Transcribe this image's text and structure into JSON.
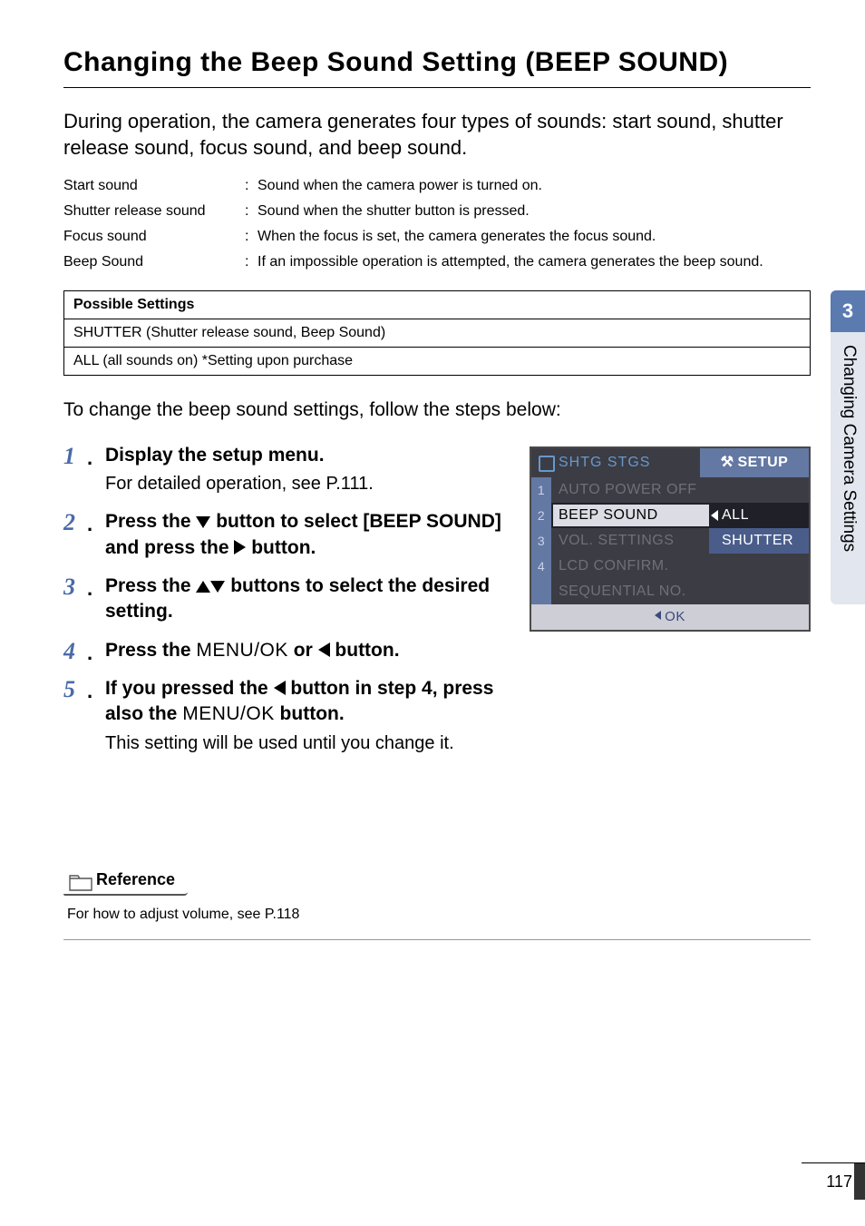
{
  "title": "Changing the Beep Sound Setting (BEEP SOUND)",
  "intro": "During operation, the camera generates four types of sounds: start sound, shutter release sound, focus sound, and beep sound.",
  "sounds": [
    {
      "name": "Start sound",
      "desc": "Sound when the camera power is turned on."
    },
    {
      "name": "Shutter release sound",
      "desc": "Sound when the shutter button is pressed."
    },
    {
      "name": "Focus sound",
      "desc": "When the focus is set, the camera generates the focus sound."
    },
    {
      "name": "Beep Sound",
      "desc": "If an impossible operation is attempted, the camera generates the beep sound."
    }
  ],
  "settings_table": {
    "header": "Possible Settings",
    "rows": [
      "SHUTTER (Shutter release sound, Beep Sound)",
      "ALL (all sounds on)  *Setting upon purchase"
    ]
  },
  "sub_intro": "To change the beep sound settings, follow the steps below:",
  "steps": {
    "s1": {
      "head": "Display the setup menu.",
      "sub": "For detailed operation, see P.111."
    },
    "s2": {
      "head_pre": "Press the ",
      "head_mid": " button to select [BEEP SOUND] and press the ",
      "head_post": " button."
    },
    "s3": {
      "head_pre": "Press the ",
      "head_post": " buttons to select the desired setting."
    },
    "s4": {
      "head_pre": "Press the ",
      "menu": "MENU/OK",
      "head_mid": " or ",
      "head_post": " button."
    },
    "s5": {
      "head_pre": "If you pressed the ",
      "head_mid": " button in step 4, press also the ",
      "menu": "MENU/OK",
      "head_post": " button.",
      "sub": "This setting will be used until you change it."
    }
  },
  "screenshot": {
    "header_left": "SHTG STGS",
    "header_right": "SETUP",
    "rows": [
      {
        "num": "1",
        "label": "AUTO POWER OFF",
        "val": ""
      },
      {
        "num": "2",
        "label": "BEEP SOUND",
        "val": "ALL",
        "selected": true,
        "arrow": true
      },
      {
        "num": "3",
        "label": "VOL. SETTINGS",
        "val": "SHUTTER",
        "valBlue": true
      },
      {
        "num": "4",
        "label": "LCD CONFIRM.",
        "val": ""
      },
      {
        "num": "",
        "label": "SEQUENTIAL NO.",
        "val": ""
      }
    ],
    "footer": "OK"
  },
  "reference": {
    "label": "Reference",
    "body": "For how to adjust volume, see P.118"
  },
  "side_tab": {
    "num": "3",
    "text": "Changing Camera Settings"
  },
  "page_number": "117"
}
